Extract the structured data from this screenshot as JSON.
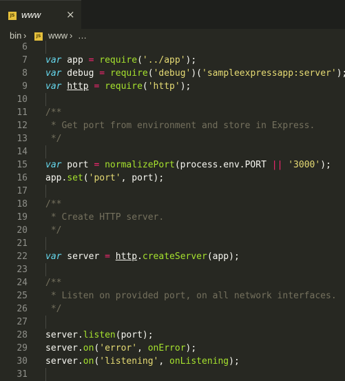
{
  "tab": {
    "label": "www",
    "close_glyph": "×",
    "icon": "js-file-icon"
  },
  "breadcrumb": {
    "folder": "bin",
    "separator": "›",
    "file": "www",
    "ellipsis": "…"
  },
  "editor": {
    "lines": [
      {
        "n": "6",
        "t": []
      },
      {
        "n": "7",
        "t": [
          [
            "var",
            "k"
          ],
          [
            " app ",
            ""
          ],
          [
            "=",
            "o"
          ],
          [
            " ",
            ""
          ],
          [
            "require",
            "f"
          ],
          [
            "(",
            ""
          ],
          [
            "'../app'",
            "s"
          ],
          [
            ");",
            ""
          ]
        ]
      },
      {
        "n": "8",
        "t": [
          [
            "var",
            "k"
          ],
          [
            " debug ",
            ""
          ],
          [
            "=",
            "o"
          ],
          [
            " ",
            ""
          ],
          [
            "require",
            "f"
          ],
          [
            "(",
            ""
          ],
          [
            "'debug'",
            "s"
          ],
          [
            ")(",
            ""
          ],
          [
            "'sampleexpressapp:server'",
            "s"
          ],
          [
            ");",
            ""
          ]
        ]
      },
      {
        "n": "9",
        "t": [
          [
            "var",
            "k"
          ],
          [
            " ",
            ""
          ],
          [
            "http",
            "u"
          ],
          [
            " ",
            ""
          ],
          [
            "=",
            "o"
          ],
          [
            " ",
            ""
          ],
          [
            "require",
            "f"
          ],
          [
            "(",
            ""
          ],
          [
            "'http'",
            "s"
          ],
          [
            ");",
            ""
          ]
        ]
      },
      {
        "n": "10",
        "t": []
      },
      {
        "n": "11",
        "t": [
          [
            "/**",
            "c"
          ]
        ]
      },
      {
        "n": "12",
        "t": [
          [
            " * Get port from environment and store in Express.",
            "c"
          ]
        ]
      },
      {
        "n": "13",
        "t": [
          [
            " */",
            "c"
          ]
        ]
      },
      {
        "n": "14",
        "t": []
      },
      {
        "n": "15",
        "t": [
          [
            "var",
            "k"
          ],
          [
            " port ",
            ""
          ],
          [
            "=",
            "o"
          ],
          [
            " ",
            ""
          ],
          [
            "normalizePort",
            "f"
          ],
          [
            "(process.env.PORT ",
            ""
          ],
          [
            "||",
            "o"
          ],
          [
            " ",
            ""
          ],
          [
            "'3000'",
            "s"
          ],
          [
            ");",
            ""
          ]
        ]
      },
      {
        "n": "16",
        "t": [
          [
            "app.",
            ""
          ],
          [
            "set",
            "f"
          ],
          [
            "(",
            ""
          ],
          [
            "'port'",
            "s"
          ],
          [
            ", port);",
            ""
          ]
        ]
      },
      {
        "n": "17",
        "t": []
      },
      {
        "n": "18",
        "t": [
          [
            "/**",
            "c"
          ]
        ]
      },
      {
        "n": "19",
        "t": [
          [
            " * Create HTTP server.",
            "c"
          ]
        ]
      },
      {
        "n": "20",
        "t": [
          [
            " */",
            "c"
          ]
        ]
      },
      {
        "n": "21",
        "t": []
      },
      {
        "n": "22",
        "t": [
          [
            "var",
            "k"
          ],
          [
            " server ",
            ""
          ],
          [
            "=",
            "o"
          ],
          [
            " ",
            ""
          ],
          [
            "http",
            "u"
          ],
          [
            ".",
            ""
          ],
          [
            "createServer",
            "f"
          ],
          [
            "(app);",
            ""
          ]
        ]
      },
      {
        "n": "23",
        "t": []
      },
      {
        "n": "24",
        "t": [
          [
            "/**",
            "c"
          ]
        ]
      },
      {
        "n": "25",
        "t": [
          [
            " * Listen on provided port, on all network interfaces.",
            "c"
          ]
        ]
      },
      {
        "n": "26",
        "t": [
          [
            " */",
            "c"
          ]
        ]
      },
      {
        "n": "27",
        "t": []
      },
      {
        "n": "28",
        "t": [
          [
            "server.",
            ""
          ],
          [
            "listen",
            "f"
          ],
          [
            "(port);",
            ""
          ]
        ]
      },
      {
        "n": "29",
        "t": [
          [
            "server.",
            ""
          ],
          [
            "on",
            "f"
          ],
          [
            "(",
            ""
          ],
          [
            "'error'",
            "s"
          ],
          [
            ", ",
            ""
          ],
          [
            "onError",
            "f"
          ],
          [
            ");",
            ""
          ]
        ]
      },
      {
        "n": "30",
        "t": [
          [
            "server.",
            ""
          ],
          [
            "on",
            "f"
          ],
          [
            "(",
            ""
          ],
          [
            "'listening'",
            "s"
          ],
          [
            ", ",
            ""
          ],
          [
            "onListening",
            "f"
          ],
          [
            ");",
            ""
          ]
        ]
      },
      {
        "n": "31",
        "t": []
      }
    ]
  },
  "colors": {
    "background": "#272822",
    "keyword": "#66d9ef",
    "operator": "#f92672",
    "function": "#a6e22e",
    "string": "#e6db74",
    "comment": "#75715e",
    "text": "#f8f8f2"
  }
}
